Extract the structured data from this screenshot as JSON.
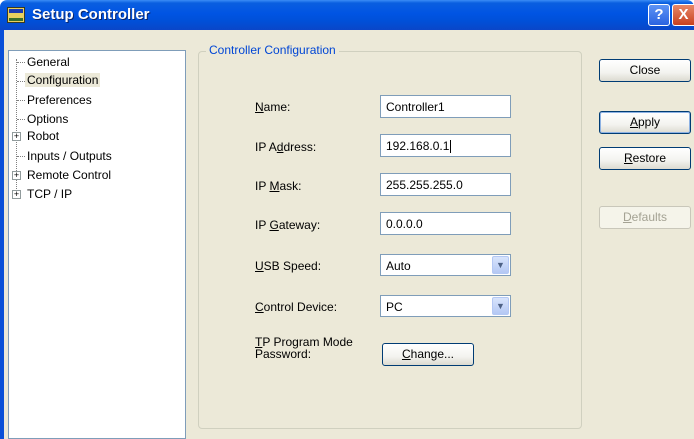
{
  "window": {
    "title": "Setup Controller",
    "help_glyph": "?",
    "close_glyph": "X"
  },
  "tree": {
    "items": [
      {
        "label": "General",
        "expandable": false,
        "selected": false
      },
      {
        "label": "Configuration",
        "expandable": false,
        "selected": true
      },
      {
        "label": "Preferences",
        "expandable": false,
        "selected": false
      },
      {
        "label": "Options",
        "expandable": false,
        "selected": false
      },
      {
        "label": "Robot",
        "expandable": true,
        "selected": false
      },
      {
        "label": "Inputs / Outputs",
        "expandable": false,
        "selected": false
      },
      {
        "label": "Remote Control",
        "expandable": true,
        "selected": false
      },
      {
        "label": "TCP / IP",
        "expandable": true,
        "selected": false
      }
    ],
    "expander_glyph": "+"
  },
  "group": {
    "title": "Controller Configuration"
  },
  "form": {
    "name": {
      "label_u": "N",
      "label_rest": "ame:",
      "value": "Controller1"
    },
    "ip_address": {
      "label_pre": "IP A",
      "label_u": "d",
      "label_rest": "dress:",
      "value": "192.168.0.1"
    },
    "ip_mask": {
      "label_pre": "IP ",
      "label_u": "M",
      "label_rest": "ask:",
      "value": "255.255.255.0"
    },
    "ip_gateway": {
      "label_pre": "IP ",
      "label_u": "G",
      "label_rest": "ateway:",
      "value": "0.0.0.0"
    },
    "usb_speed": {
      "label_u": "U",
      "label_rest": "SB Speed:",
      "value": "Auto"
    },
    "control_device": {
      "label_u": "C",
      "label_rest": "ontrol Device:",
      "value": "PC"
    },
    "tp_password": {
      "label_u": "T",
      "label_line1_rest": "P Program Mode",
      "label_line2": "Password:"
    },
    "change_button": {
      "label_u": "C",
      "label_rest": "hange..."
    },
    "dropdown_glyph": "▼"
  },
  "buttons": {
    "close": "Close",
    "apply": {
      "label_u": "A",
      "label_rest": "pply"
    },
    "restore": {
      "label_u": "R",
      "label_rest": "estore"
    },
    "defaults": {
      "label_u": "D",
      "label_rest": "efaults"
    }
  }
}
